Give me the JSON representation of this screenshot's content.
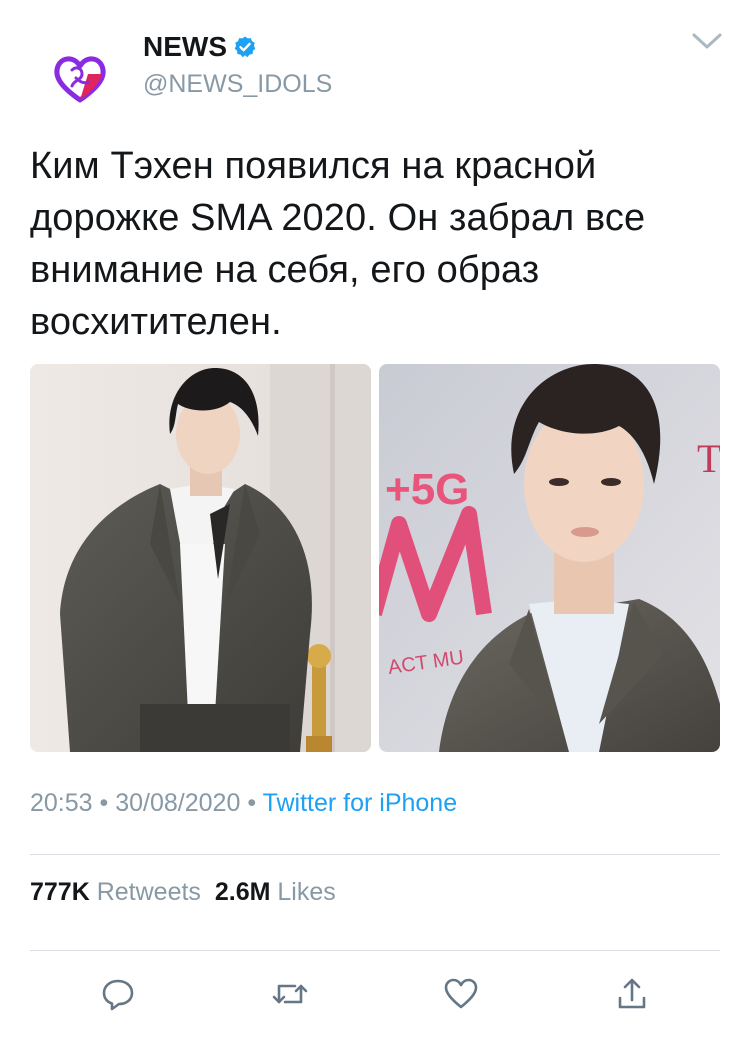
{
  "author": {
    "display_name": "NEWS",
    "handle": "@NEWS_IDOLS",
    "verified": true,
    "avatar_icon": "heart-hand-logo-icon"
  },
  "tweet": {
    "text": "Ким Тэхен появился на красной дорожке SMA 2020. Он забрал все внимание на себя, его образ восхитителен.",
    "media": [
      {
        "alt": "Photo of a man in a gray suit on a red carpet"
      },
      {
        "alt": "Close-up photo of a man in a gray suit in front of a 5G banner"
      }
    ],
    "banner_text": {
      "five_g": "+5G",
      "t": "T",
      "act": "ACT MU"
    },
    "time": "20:53",
    "separator": "•",
    "date": "30/08/2020",
    "source": "Twitter for iPhone"
  },
  "stats": {
    "retweets_count": "777K",
    "retweets_label": "Retweets",
    "likes_count": "2.6M",
    "likes_label": "Likes"
  },
  "icons": {
    "reply": "reply-icon",
    "retweet": "retweet-icon",
    "like": "heart-icon",
    "share": "share-icon",
    "menu": "chevron-down-icon"
  },
  "colors": {
    "text": "#14171a",
    "secondary": "#8899a6",
    "link": "#1da1f2",
    "verified": "#1da1f2",
    "avatar_accent": "#e0245e"
  }
}
